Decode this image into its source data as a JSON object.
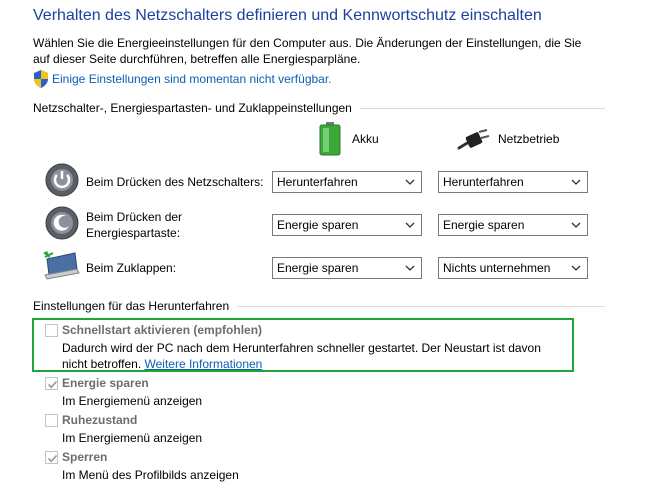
{
  "page": {
    "title": "Verhalten des Netzschalters definieren und Kennwortschutz einschalten",
    "description": "Wählen Sie die Energieeinstellungen für den Computer aus. Die Änderungen der Einstellungen, die Sie auf dieser Seite durchführen, betreffen alle Energiesparpläne.",
    "unavailable_link": "Einige Einstellungen sind momentan nicht verfügbar."
  },
  "buttons_section": {
    "header": "Netzschalter-, Energiespartasten- und Zuklappeinstellungen",
    "col_battery": "Akku",
    "col_power": "Netzbetrieb",
    "rows": [
      {
        "label": "Beim Drücken des Netzschalters:",
        "battery": "Herunterfahren",
        "power": "Herunterfahren"
      },
      {
        "label": "Beim Drücken der Energiespartaste:",
        "label_line1": "Beim Drücken der",
        "label_line2": "Energiespartaste:",
        "battery": "Energie sparen",
        "power": "Energie sparen"
      },
      {
        "label": "Beim Zuklappen:",
        "battery": "Energie sparen",
        "power": "Nichts unternehmen"
      }
    ]
  },
  "shutdown_section": {
    "header": "Einstellungen für das Herunterfahren",
    "options": [
      {
        "title": "Schnellstart aktivieren (empfohlen)",
        "checked": false,
        "desc": "Dadurch wird der PC nach dem Herunterfahren schneller gestartet. Der Neustart ist davon nicht betroffen.",
        "link": "Weitere Informationen"
      },
      {
        "title": "Energie sparen",
        "checked": true,
        "desc": "Im Energiemenü anzeigen"
      },
      {
        "title": "Ruhezustand",
        "checked": false,
        "desc": "Im Energiemenü anzeigen"
      },
      {
        "title": "Sperren",
        "checked": true,
        "desc": "Im Menü des Profilbilds anzeigen"
      }
    ]
  },
  "colors": {
    "title": "#1e3f9e",
    "link": "#0a5fb4",
    "highlight": "#22a33a"
  }
}
